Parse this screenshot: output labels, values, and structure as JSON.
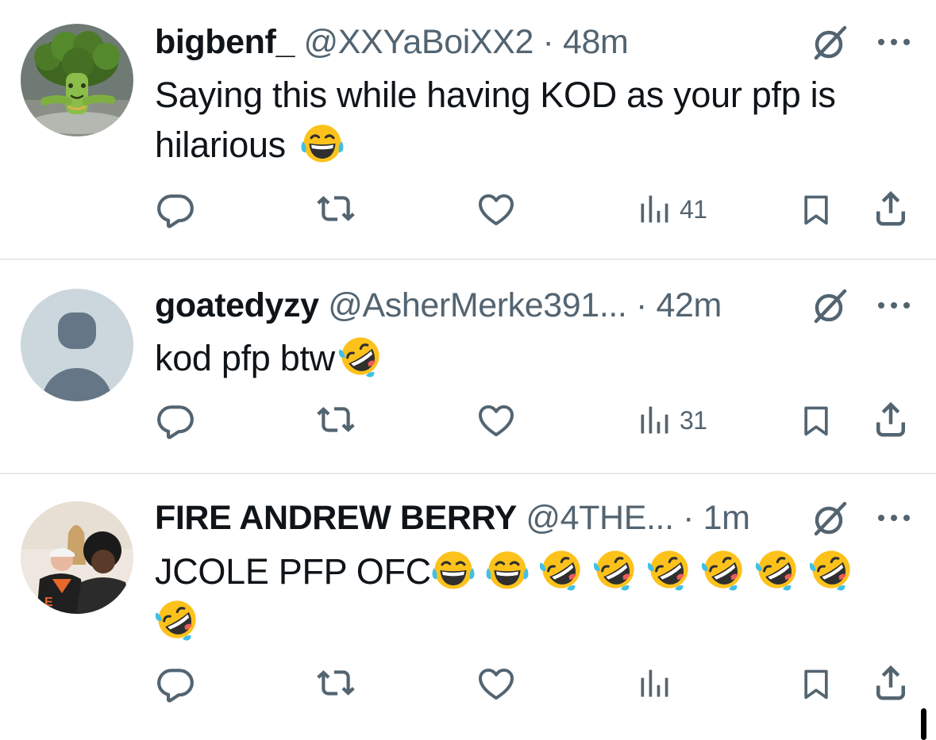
{
  "tweets": [
    {
      "display_name": "bigbenf_",
      "handle": "@XXYaBoiXX2",
      "separator": "·",
      "time": "48m",
      "text": "Saying this while having KOD as your pfp is hilarious",
      "emojis": [
        "face-with-tears-of-joy"
      ],
      "views": "41",
      "avatar": "broccoli-character-avatar"
    },
    {
      "display_name": "goatedyzy",
      "handle": "@AsherMerke391...",
      "separator": "·",
      "time": "42m",
      "text": "kod pfp btw",
      "emojis": [
        "rolling-on-the-floor-laughing"
      ],
      "views": "31",
      "avatar": "default-profile-avatar"
    },
    {
      "display_name": "FIRE ANDREW BERRY",
      "handle": "@4THE...",
      "separator": "·",
      "time": "1m",
      "text": "JCOLE PFP OFC",
      "emojis": [
        "face-with-tears-of-joy",
        "face-with-tears-of-joy",
        "rolling-on-the-floor-laughing",
        "rolling-on-the-floor-laughing",
        "rolling-on-the-floor-laughing",
        "rolling-on-the-floor-laughing",
        "rolling-on-the-floor-laughing",
        "rolling-on-the-floor-laughing",
        "rolling-on-the-floor-laughing"
      ],
      "views": "",
      "avatar": "photo-two-people-avatar"
    }
  ],
  "icons": {
    "reply": "speech-bubble-icon",
    "retweet": "retweet-arrows-icon",
    "like": "heart-icon",
    "views": "bar-chart-icon",
    "bookmark": "bookmark-icon",
    "share": "share-upload-icon",
    "grok": "grok-slash-icon",
    "more": "three-dots-icon"
  },
  "colors": {
    "text_primary": "#0f1419",
    "text_secondary": "#536471",
    "divider": "#e6e9ec",
    "emoji_yellow": "#fcc21b",
    "tear_blue": "#40c0e7"
  }
}
